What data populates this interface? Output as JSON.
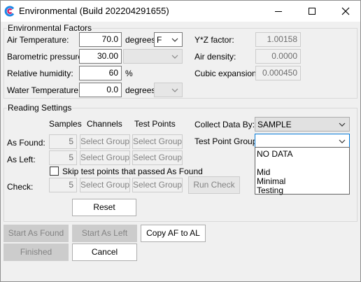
{
  "window": {
    "title": "Environmental (Build 202204291655)",
    "icons": {
      "app": "app-logo-icon",
      "minimize": "minimize-icon",
      "maximize": "maximize-icon",
      "close": "close-icon"
    }
  },
  "env": {
    "legend": "Environmental Factors",
    "air_temp_label": "Air Temperature:",
    "air_temp_value": "70.0",
    "air_temp_unit": "degrees",
    "air_temp_unit_select": "F",
    "baro_label": "Barometric pressure:",
    "baro_value": "30.00",
    "humidity_label": "Relative humidity:",
    "humidity_value": "60",
    "humidity_unit": "%",
    "water_temp_label": "Water Temperature:",
    "water_temp_value": "0.0",
    "water_temp_unit": "degrees",
    "yz_label": "Y*Z factor:",
    "yz_value": "1.00158",
    "air_density_label": "Air density:",
    "air_density_value": "0.0000",
    "cubic_label": "Cubic expansion:",
    "cubic_value": "0.000450"
  },
  "reading": {
    "legend": "Reading Settings",
    "col_samples": "Samples",
    "col_channels": "Channels",
    "col_test_points": "Test Points",
    "as_found_label": "As Found:",
    "as_found_samples": "5",
    "as_left_label": "As Left:",
    "as_left_samples": "5",
    "check_label": "Check:",
    "check_samples": "5",
    "select_group": "Select Group",
    "skip_label": "Skip test points that passed As Found",
    "run_check": "Run Check",
    "collect_label": "Collect Data By:",
    "collect_value": "SAMPLE",
    "tpg_label": "Test Point Group:",
    "tpg_value": "",
    "tpg_options": [
      "NO DATA",
      "",
      "Mid",
      "Minimal",
      "Testing"
    ],
    "reset": "Reset"
  },
  "footer": {
    "start_as_found": "Start As Found",
    "start_as_left": "Start As Left",
    "copy_af_al": "Copy AF to AL",
    "finished": "Finished",
    "cancel": "Cancel"
  }
}
